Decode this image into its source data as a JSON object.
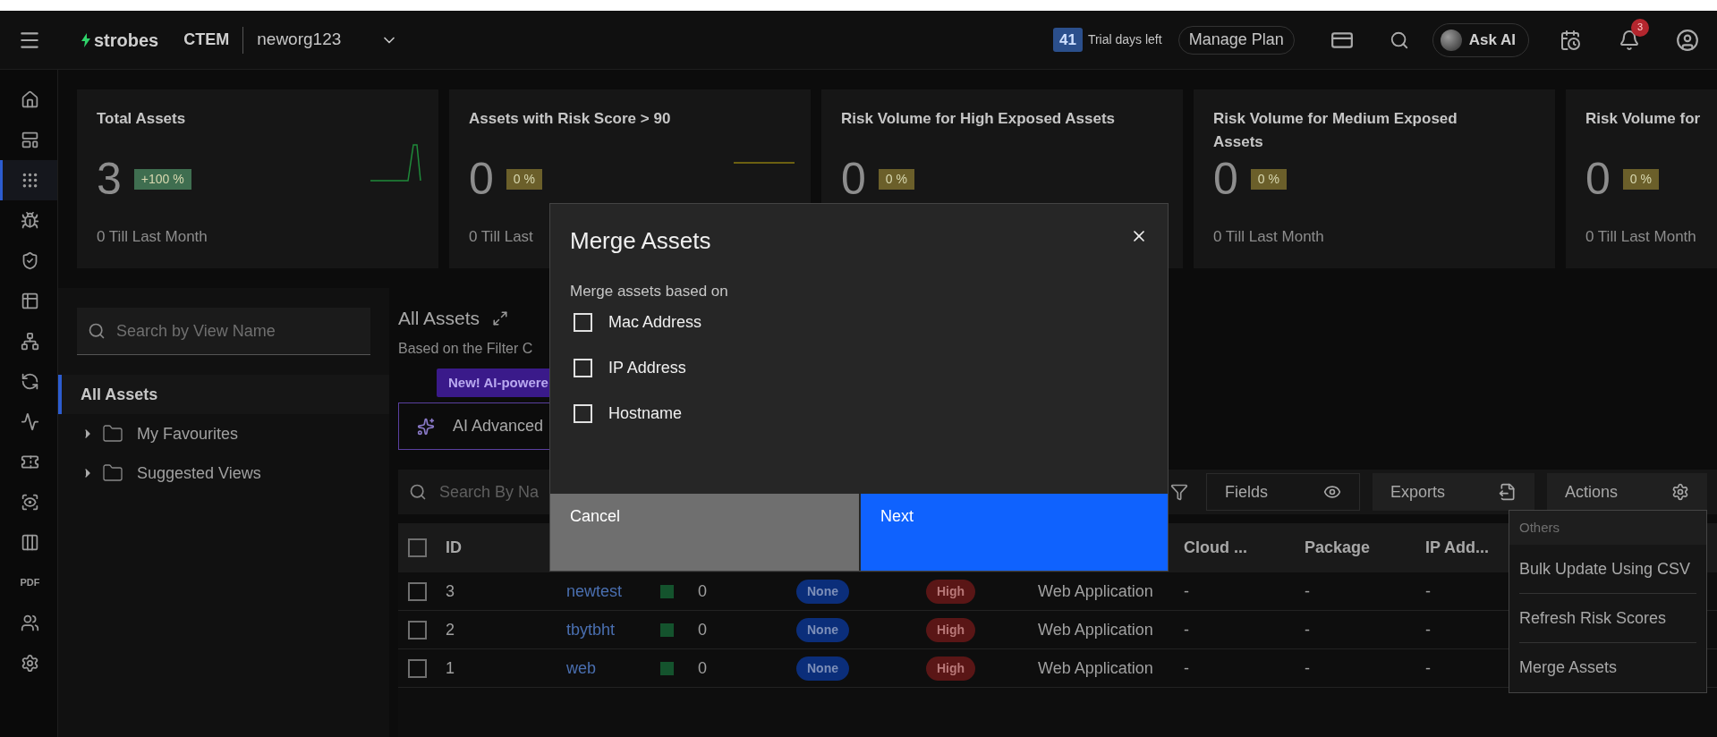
{
  "header": {
    "brand": "strobes",
    "product": "CTEM",
    "org": "neworg123",
    "trial_days": "41",
    "trial_label": "Trial days left",
    "manage_plan": "Manage Plan",
    "ask_ai": "Ask AI",
    "notifications": "3"
  },
  "sidebar": {
    "items": [
      {
        "kind": "icon",
        "selected": false
      },
      {
        "kind": "icon",
        "selected": false
      },
      {
        "kind": "icon",
        "selected": true
      },
      {
        "kind": "icon",
        "selected": false
      },
      {
        "kind": "icon",
        "selected": false
      },
      {
        "kind": "icon",
        "selected": false
      },
      {
        "kind": "icon",
        "selected": false
      },
      {
        "kind": "icon",
        "selected": false
      },
      {
        "kind": "icon",
        "selected": false
      },
      {
        "kind": "icon",
        "selected": false
      },
      {
        "kind": "icon",
        "selected": false
      },
      {
        "kind": "icon",
        "selected": false
      },
      {
        "kind": "text",
        "label": "PDF",
        "selected": false
      },
      {
        "kind": "icon",
        "selected": false
      },
      {
        "kind": "icon",
        "selected": false
      }
    ]
  },
  "cards": [
    {
      "title": "Total Assets",
      "value": "3",
      "change": "+100 %",
      "color": "#3f6e50",
      "footer": "0 Till Last Month"
    },
    {
      "title": "Assets with Risk Score > 90",
      "value": "0",
      "change": "0 %",
      "color": "#6b5f2a",
      "footer": "0 Till Last"
    },
    {
      "title": "Risk Volume for High Exposed Assets",
      "value": "0",
      "change": "0 %",
      "color": "#6b5f2a"
    },
    {
      "title": "Risk Volume for Medium Exposed Assets",
      "value": "0",
      "change": "0 %",
      "color": "#6b5f2a",
      "footer": "0 Till Last Month"
    },
    {
      "title": "Risk Volume for",
      "value": "0",
      "change": "0 %",
      "color": "#6b5f2a",
      "footer": "0 Till Last Month"
    }
  ],
  "views": {
    "search_placeholder": "Search by View Name",
    "items": [
      {
        "kind": "view",
        "label": "All Assets",
        "selected": true
      },
      {
        "kind": "folder",
        "label": "My Favourites",
        "selected": false
      },
      {
        "kind": "folder",
        "label": "Suggested Views",
        "selected": false
      }
    ]
  },
  "main": {
    "title": "All Assets",
    "subtitle": "Based on the Filter C",
    "ai_tip": "New! AI-powere",
    "ai_button": "AI Advanced",
    "search_placeholder": "Search By Na",
    "fields": "Fields",
    "exports": "Exports",
    "actions": "Actions"
  },
  "table": {
    "select_all": {
      "checked": false
    },
    "columns": [
      {
        "label": "ID"
      },
      {
        "label": "Cloud ..."
      },
      {
        "label": "Package"
      },
      {
        "label": "IP Add..."
      }
    ],
    "rows": [
      {
        "checked": false,
        "id": "3",
        "name": "newtest",
        "score": "0",
        "severity": "None",
        "risk": "High",
        "type": "Web Application",
        "cloud": "-",
        "package": "-",
        "ip": "-"
      },
      {
        "checked": false,
        "id": "2",
        "name": "tbytbht",
        "score": "0",
        "severity": "None",
        "risk": "High",
        "type": "Web Application",
        "cloud": "-",
        "package": "-",
        "ip": "-"
      },
      {
        "checked": false,
        "id": "1",
        "name": "web",
        "score": "0",
        "severity": "None",
        "risk": "High",
        "type": "Web Application",
        "cloud": "-",
        "package": "-",
        "ip": "-"
      }
    ]
  },
  "actions_menu": {
    "section": "Others",
    "items": [
      "Bulk Update Using CSV",
      "Refresh Risk Scores",
      "Merge Assets"
    ]
  },
  "modal": {
    "title": "Merge Assets",
    "label": "Merge assets based on",
    "options": [
      {
        "label": "Mac Address",
        "checked": false
      },
      {
        "label": "IP Address",
        "checked": false
      },
      {
        "label": "Hostname",
        "checked": false
      }
    ],
    "cancel": "Cancel",
    "next": "Next"
  }
}
